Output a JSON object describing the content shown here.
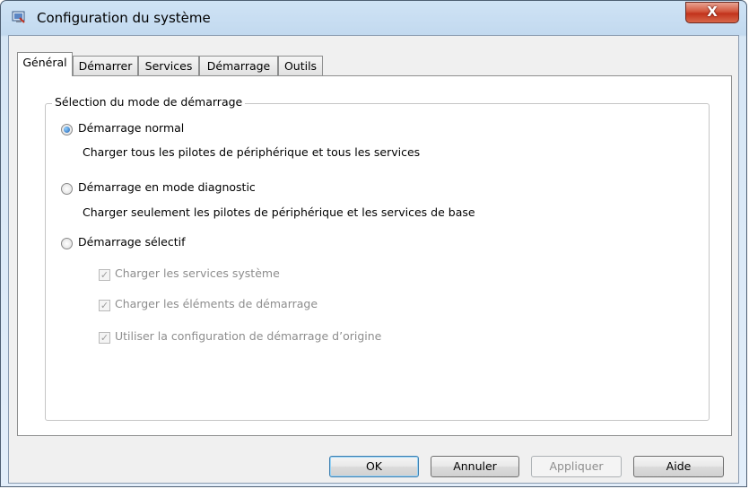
{
  "window": {
    "title": "Configuration du système",
    "close_symbol": "X"
  },
  "tabs": [
    {
      "label": "Général",
      "active": true
    },
    {
      "label": "Démarrer",
      "active": false
    },
    {
      "label": "Services",
      "active": false
    },
    {
      "label": "Démarrage",
      "active": false
    },
    {
      "label": "Outils",
      "active": false
    }
  ],
  "group": {
    "legend": "Sélection du mode de démarrage",
    "options": [
      {
        "label": "Démarrage normal",
        "description": "Charger tous les pilotes de périphérique et tous les services",
        "selected": true
      },
      {
        "label": "Démarrage en mode diagnostic",
        "description": "Charger seulement les pilotes de périphérique et les services de base",
        "selected": false
      },
      {
        "label": "Démarrage sélectif",
        "description": "",
        "selected": false
      }
    ],
    "selective_checks": [
      {
        "label": "Charger les services système",
        "checked": true,
        "enabled": false
      },
      {
        "label": "Charger les éléments de démarrage",
        "checked": true,
        "enabled": false
      },
      {
        "label": "Utiliser la configuration de démarrage d’origine",
        "checked": true,
        "enabled": false
      }
    ]
  },
  "buttons": {
    "ok": "OK",
    "cancel": "Annuler",
    "apply": "Appliquer",
    "help": "Aide"
  },
  "colors": {
    "selected_radio": "#1f5fb0",
    "close_button": "#c2331c",
    "disabled_text": "#8d8d8d"
  }
}
